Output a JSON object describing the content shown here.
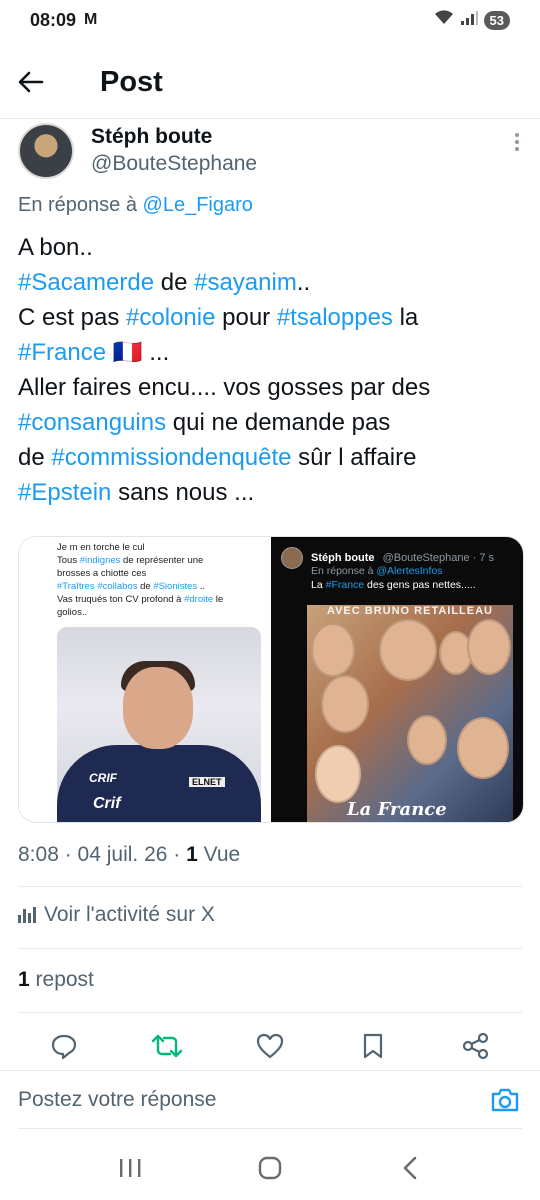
{
  "status": {
    "time": "08:09",
    "battery": "53"
  },
  "header": {
    "title": "Post"
  },
  "author": {
    "display_name": "Stéph boute",
    "handle": "@BouteStephane"
  },
  "reply_to": {
    "prefix": "En réponse à",
    "handle": "@Le_Figaro"
  },
  "tweet": {
    "line1": "A bon..",
    "line2_tag1": "#Sacamerde",
    "line2_mid": " de ",
    "line2_tag2": "#sayanim",
    "line2_end": "..",
    "line3_start": "C est pas ",
    "line3_tag1": "#colonie",
    "line3_mid": " pour ",
    "line3_tag2": "#tsaloppes",
    "line3_end": " la",
    "line4_tag": "#France",
    "line4_end": " 🇫🇷 ...",
    "line5": "Aller faires encu.... vos gosses par des",
    "line6_tag": "#consanguins",
    "line6_end": " qui ne demande pas",
    "line7_start": "de ",
    "line7_tag": "#commissiondenquête",
    "line7_end": " sûr l affaire",
    "line8_tag": "#Epstein",
    "line8_end": " sans nous ..."
  },
  "media_left": {
    "l1": "Je m en torche le cul",
    "l2a": "Tous ",
    "l2tag": "#indignes",
    "l2b": " de représenter une",
    "l3": "brosses a chiotte ces",
    "l4tag1": "#Traîtres",
    "l4tag2": "#collabos",
    "l4mid": " de ",
    "l4tag3": "#Sionistes",
    "l4end": " ..",
    "l5a": "Vas truqués ton CV profond à ",
    "l5tag": "#droite",
    "l5end": " le",
    "l6": "golios..",
    "photo_label1": "CRIF",
    "photo_label2": "ELNET",
    "photo_label3": "Crif"
  },
  "media_right": {
    "name": "Stéph boute",
    "handle": "@BouteStephane · 7 s",
    "reply_prefix": "En réponse à ",
    "reply_handle": "@AlertesInfos",
    "text_start": "La ",
    "text_tag": "#France",
    "text_end": " des gens pas nettes.....",
    "collage_title": "AVEC BRUNO RETAILLEAU",
    "collage_logo": "La France"
  },
  "meta": {
    "time_date": "8:08 · 04 juil. 26 · ",
    "views_count": "1",
    "views_label": " Vue"
  },
  "activity": {
    "label": "Voir l'activité sur X"
  },
  "reposts": {
    "count": "1",
    "label": " repost"
  },
  "reply_bar": {
    "placeholder": "Postez votre réponse"
  },
  "colors": {
    "accent": "#1d9bf0",
    "repost": "#00ba7c",
    "secondary_text": "#536471"
  }
}
